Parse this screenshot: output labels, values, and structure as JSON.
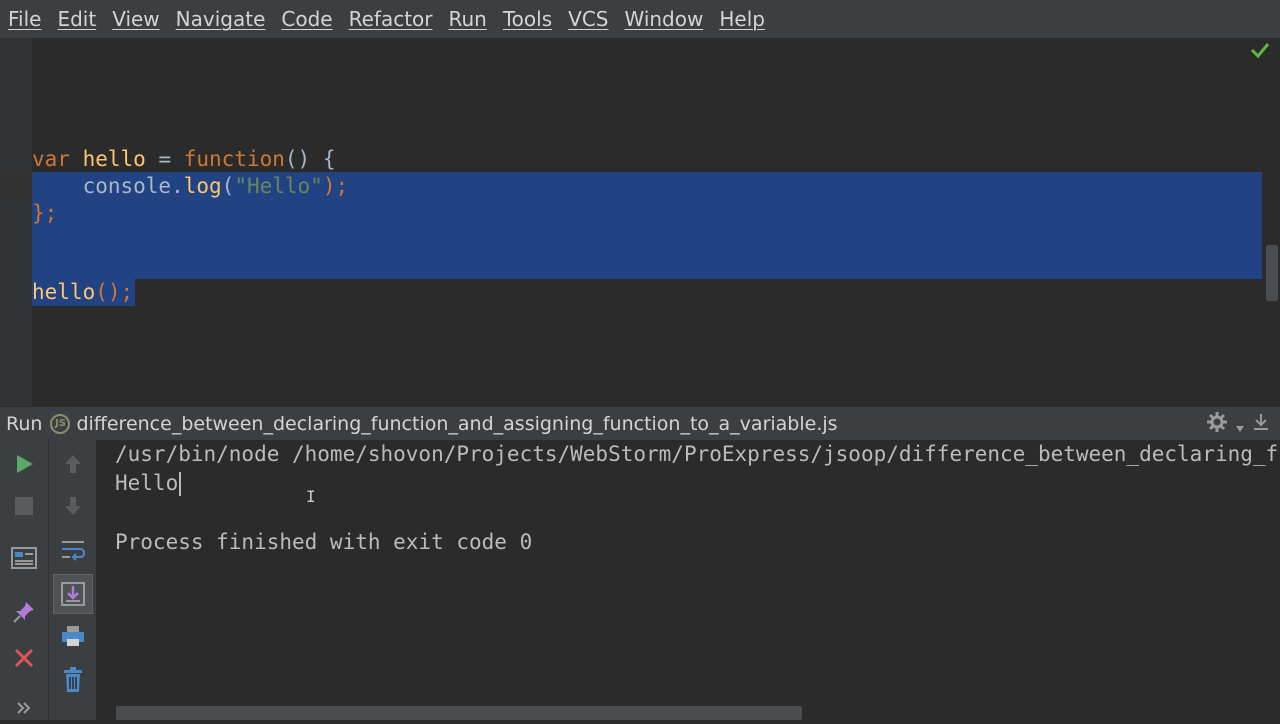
{
  "menu": [
    "File",
    "Edit",
    "View",
    "Navigate",
    "Code",
    "Refactor",
    "Run",
    "Tools",
    "VCS",
    "Window",
    "Help"
  ],
  "editor": {
    "line1": {
      "kw1": "var",
      "name": " hello",
      "eq": " = ",
      "kw2": "function",
      "rest": "() {"
    },
    "line2": {
      "indent": "    console.",
      "call": "log",
      "open": "(",
      "str": "\"Hello\"",
      "close": ");"
    },
    "line3": "};",
    "line5": {
      "call": "hello",
      "rest": "();"
    }
  },
  "run": {
    "label": "Run",
    "js_badge": "JS",
    "file": "difference_between_declaring_function_and_assigning_function_to_a_variable.js"
  },
  "console": {
    "line1": "/usr/bin/node /home/shovon/Projects/WebStorm/ProExpress/jsoop/difference_between_declaring_function_and_assigning_function_to_a_variable.js",
    "line2": "Hello",
    "line3": "Process finished with exit code 0"
  },
  "colors": {
    "accent_selection": "#214283",
    "run_green": "#59a869",
    "stop_red": "#e05555",
    "check_green": "#62b543"
  }
}
